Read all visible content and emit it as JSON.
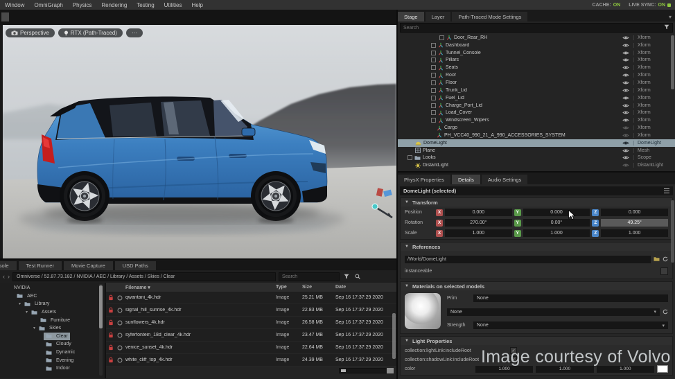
{
  "menu_bar": {
    "items": [
      "Window",
      "OmniGraph",
      "Physics",
      "Rendering",
      "Testing",
      "Utilities",
      "Help"
    ],
    "cache_label": "CACHE:",
    "cache_value": "ON",
    "live_sync_label": "LIVE SYNC:",
    "live_sync_value": "ON",
    "status_on_color": "#8dc63f"
  },
  "viewport": {
    "camera_button": "Perspective",
    "renderer_button": "RTX (Path-Traced)",
    "more_button": "⋯"
  },
  "watermark": "Image courtesy of Volvo",
  "icons": {
    "chevron_down": "▾",
    "section_triangle": "▼",
    "sort_desc": "▾",
    "breadcrumb_back": "‹",
    "breadcrumb_fwd": "›"
  },
  "stage_panel": {
    "tabs": [
      {
        "label": "Stage",
        "active": true
      },
      {
        "label": "Layer",
        "active": false
      },
      {
        "label": "Path-Traced Mode Settings",
        "active": false
      }
    ],
    "search_placeholder": "Search",
    "rows": [
      {
        "label": "Door_Rear_RH",
        "type": "Xform",
        "indent": 3.4,
        "icon": "xform",
        "box": true
      },
      {
        "label": "Dashboard",
        "type": "Xform",
        "indent": 2.6,
        "icon": "xform",
        "box": true
      },
      {
        "label": "Tunnel_Console",
        "type": "Xform",
        "indent": 2.6,
        "icon": "xform",
        "box": true
      },
      {
        "label": "Pillars",
        "type": "Xform",
        "indent": 2.6,
        "icon": "xform",
        "box": true
      },
      {
        "label": "Seats",
        "type": "Xform",
        "indent": 2.6,
        "icon": "xform",
        "box": true
      },
      {
        "label": "Roof",
        "type": "Xform",
        "indent": 2.6,
        "icon": "xform",
        "box": true
      },
      {
        "label": "Floor",
        "type": "Xform",
        "indent": 2.6,
        "icon": "xform",
        "box": true
      },
      {
        "label": "Trunk_Lid",
        "type": "Xform",
        "indent": 2.6,
        "icon": "xform",
        "box": true
      },
      {
        "label": "Fuel_Lid",
        "type": "Xform",
        "indent": 2.6,
        "icon": "xform",
        "box": true
      },
      {
        "label": "Charge_Port_Lid",
        "type": "Xform",
        "indent": 2.6,
        "icon": "xform",
        "box": true
      },
      {
        "label": "Load_Cover",
        "type": "Xform",
        "indent": 2.6,
        "icon": "xform",
        "box": true
      },
      {
        "label": "Windscreen_Wipers",
        "type": "Xform",
        "indent": 2.6,
        "icon": "xform",
        "box": true
      },
      {
        "label": "Cargo",
        "type": "Xform",
        "indent": 3.1,
        "icon": "xform",
        "box": false,
        "dim": true
      },
      {
        "label": "PH_VCC40_990_21_A_990_ACCESSORIES_SYSTEM",
        "type": "Xform",
        "indent": 3.1,
        "icon": "xform",
        "box": false,
        "dim": true
      },
      {
        "label": "DomeLight",
        "type": "DomeLight",
        "indent": 1.2,
        "icon": "dome",
        "box": false,
        "selected": true
      },
      {
        "label": "Plane",
        "type": "Mesh",
        "indent": 1.2,
        "icon": "mesh",
        "box": false
      },
      {
        "label": "Looks",
        "type": "Scope",
        "indent": 0.5,
        "icon": "folder",
        "box": true
      },
      {
        "label": "DistantLight",
        "type": "DistantLight",
        "indent": 1.2,
        "icon": "distant",
        "box": false,
        "dim": true
      }
    ]
  },
  "properties_panel": {
    "tabs": [
      {
        "label": "PhysX Properties",
        "active": false
      },
      {
        "label": "Details",
        "active": true
      },
      {
        "label": "Audio Settings",
        "active": false
      }
    ],
    "selection_header": "DomeLight (selected)",
    "transform": {
      "header": "Transform",
      "axis_letters": [
        "X",
        "Y",
        "Z"
      ],
      "axis_colors": {
        "x": "#b0504f",
        "y": "#5a9a4a",
        "z": "#4a86c8"
      },
      "rows": [
        {
          "label": "Position",
          "x": "0.000",
          "y": "0.000",
          "z": "0.000"
        },
        {
          "label": "Rotation",
          "x": "270.00°",
          "y": "0.00°",
          "z": "49.25°",
          "z_edit": true
        },
        {
          "label": "Scale",
          "x": "1.000",
          "y": "1.000",
          "z": "1.000"
        }
      ]
    },
    "references": {
      "header": "References",
      "path": "/World/DomeLight",
      "instanceable_label": "instanceable"
    },
    "materials": {
      "header": "Materials on selected models",
      "prim_label": "Prim",
      "prim_value": "None",
      "material_value": "None",
      "strength_label": "Strength",
      "strength_value": "None"
    },
    "light_properties": {
      "header": "Light Properties",
      "checkbox_rows": [
        {
          "label": "collection:lightLink:includeRoot",
          "checked": true
        },
        {
          "label": "collection:shadowLink:includeRoot",
          "checked": true
        }
      ],
      "color_label": "color",
      "color_values": [
        "1.000",
        "1.000",
        "1.000"
      ]
    }
  },
  "content_browser": {
    "tabs": [
      {
        "label": "Console",
        "active": false,
        "clipped": true
      },
      {
        "label": "Test Runner",
        "active": false
      },
      {
        "label": "Movie Capture",
        "active": false
      },
      {
        "label": "USD Paths",
        "active": false
      }
    ],
    "breadcrumb": "Omniverse / 52.87.73.182 / NVIDIA / AEC / Library / Assets / Skies / Clear",
    "search_placeholder": "Search",
    "folder_tree": [
      {
        "label": "NVIDIA",
        "indent": 0,
        "icon": false
      },
      {
        "label": "AEC",
        "indent": 0.8,
        "icon": true
      },
      {
        "label": "Library",
        "indent": 1.6,
        "expander": "▾",
        "icon": true
      },
      {
        "label": "Assets",
        "indent": 2.4,
        "expander": "▾",
        "icon": true
      },
      {
        "label": "Furniture",
        "indent": 3.4,
        "icon": true
      },
      {
        "label": "Skies",
        "indent": 3.2,
        "expander": "▾",
        "icon": true
      },
      {
        "label": "Clear",
        "indent": 4.0,
        "icon": true,
        "selected": true
      },
      {
        "label": "Cloudy",
        "indent": 4.0,
        "icon": true
      },
      {
        "label": "Dynamic",
        "indent": 4.0,
        "icon": true
      },
      {
        "label": "Evening",
        "indent": 4.0,
        "icon": true
      },
      {
        "label": "Indoor",
        "indent": 4.0,
        "icon": true
      }
    ],
    "columns": [
      "Filename",
      "Type",
      "Size",
      "Date"
    ],
    "files": [
      {
        "name": "qwantani_4k.hdr",
        "type": "Image",
        "size": "25.21 MB",
        "date": "Sep 16 17:37:29 2020"
      },
      {
        "name": "signal_hill_sunrise_4k.hdr",
        "type": "Image",
        "size": "22.83 MB",
        "date": "Sep 16 17:37:29 2020"
      },
      {
        "name": "sunflowers_4k.hdr",
        "type": "Image",
        "size": "26.58 MB",
        "date": "Sep 16 17:37:29 2020"
      },
      {
        "name": "syferfontein_18d_clear_4k.hdr",
        "type": "Image",
        "size": "23.47 MB",
        "date": "Sep 16 17:37:29 2020"
      },
      {
        "name": "venice_sunset_4k.hdr",
        "type": "Image",
        "size": "22.64 MB",
        "date": "Sep 16 17:37:29 2020"
      },
      {
        "name": "white_cliff_top_4k.hdr",
        "type": "Image",
        "size": "24.39 MB",
        "date": "Sep 16 17:37:29 2020"
      }
    ]
  }
}
